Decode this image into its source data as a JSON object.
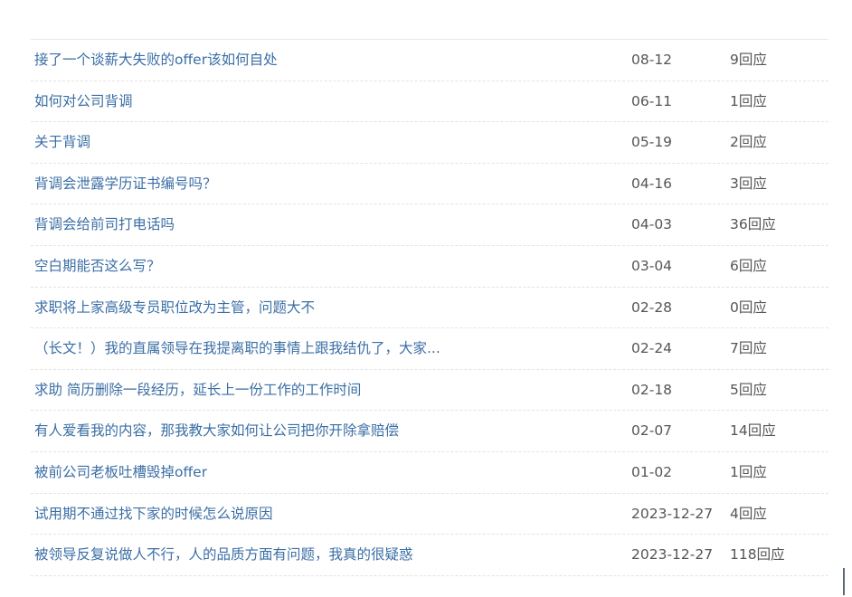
{
  "threads": [
    {
      "title": "接了一个谈薪大失败的offer该如何自处",
      "date": "08-12",
      "replies": "9回应"
    },
    {
      "title": "如何对公司背调",
      "date": "06-11",
      "replies": "1回应"
    },
    {
      "title": "关于背调",
      "date": "05-19",
      "replies": "2回应"
    },
    {
      "title": "背调会泄露学历证书编号吗？",
      "date": "04-16",
      "replies": "3回应"
    },
    {
      "title": "背调会给前司打电话吗",
      "date": "04-03",
      "replies": "36回应"
    },
    {
      "title": "空白期能否这么写？",
      "date": "03-04",
      "replies": "6回应"
    },
    {
      "title": "求职将上家高级专员职位改为主管，问题大不",
      "date": "02-28",
      "replies": "0回应"
    },
    {
      "title": "（长文！）我的直属领导在我提离职的事情上跟我结仇了，大家...",
      "date": "02-24",
      "replies": "7回应"
    },
    {
      "title": "求助 简历删除一段经历，延长上一份工作的工作时间",
      "date": "02-18",
      "replies": "5回应"
    },
    {
      "title": "有人爱看我的内容，那我教大家如何让公司把你开除拿赔偿",
      "date": "02-07",
      "replies": "14回应"
    },
    {
      "title": "被前公司老板吐槽毁掉offer",
      "date": "01-02",
      "replies": "1回应"
    },
    {
      "title": "试用期不通过找下家的时候怎么说原因",
      "date": "2023-12-27",
      "replies": "4回应"
    },
    {
      "title": "被领导反复说做人不行，人的品质方面有问题，我真的很疑惑",
      "date": "2023-12-27",
      "replies": "118回应"
    }
  ]
}
